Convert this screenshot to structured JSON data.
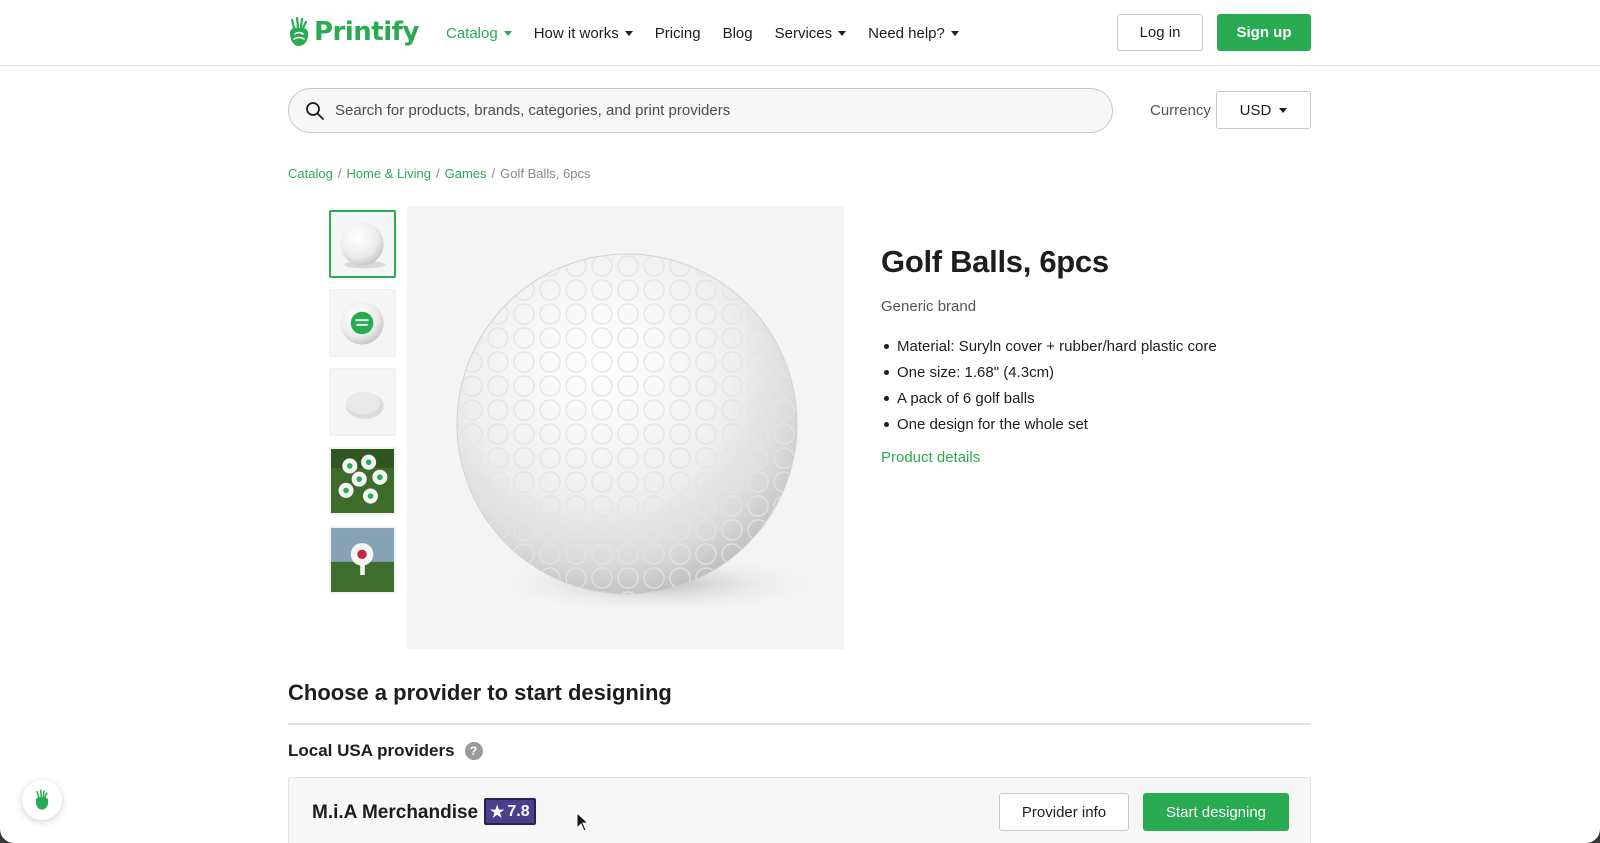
{
  "header": {
    "logo_text": "Printify",
    "nav": [
      {
        "label": "Catalog",
        "has_caret": true,
        "active": true
      },
      {
        "label": "How it works",
        "has_caret": true,
        "active": false
      },
      {
        "label": "Pricing",
        "has_caret": false,
        "active": false
      },
      {
        "label": "Blog",
        "has_caret": false,
        "active": false
      },
      {
        "label": "Services",
        "has_caret": true,
        "active": false
      },
      {
        "label": "Need help?",
        "has_caret": true,
        "active": false
      }
    ],
    "login_label": "Log in",
    "signup_label": "Sign up"
  },
  "search": {
    "placeholder": "Search for products, brands, categories, and print providers",
    "icon": "search-icon"
  },
  "currency": {
    "label": "Currency",
    "value": "USD"
  },
  "breadcrumb": [
    {
      "label": "Catalog",
      "link": true
    },
    {
      "label": "Home & Living",
      "link": true
    },
    {
      "label": "Games",
      "link": true
    },
    {
      "label": "Golf Balls, 6pcs",
      "link": false
    }
  ],
  "breadcrumb_separator": "/",
  "gallery": {
    "selected_index": 0,
    "thumbnail_count": 5
  },
  "product": {
    "title": "Golf Balls, 6pcs",
    "brand": "Generic brand",
    "features": [
      "Material: Suryln cover + rubber/hard plastic core",
      "One size: 1.68\" (4.3cm)",
      "A pack of 6 golf balls",
      "One design for the whole set"
    ],
    "details_link": "Product details"
  },
  "providers": {
    "section_title": "Choose a provider to start designing",
    "group_title": "Local USA providers",
    "help_glyph": "?",
    "items": [
      {
        "name": "M.i.A Merchandise",
        "rating": "7.8",
        "rating_star": "★",
        "info_label": "Provider info",
        "start_label": "Start designing"
      }
    ]
  },
  "colors": {
    "brand_green": "#29ab51",
    "rating_purple": "#4b3e8a"
  }
}
